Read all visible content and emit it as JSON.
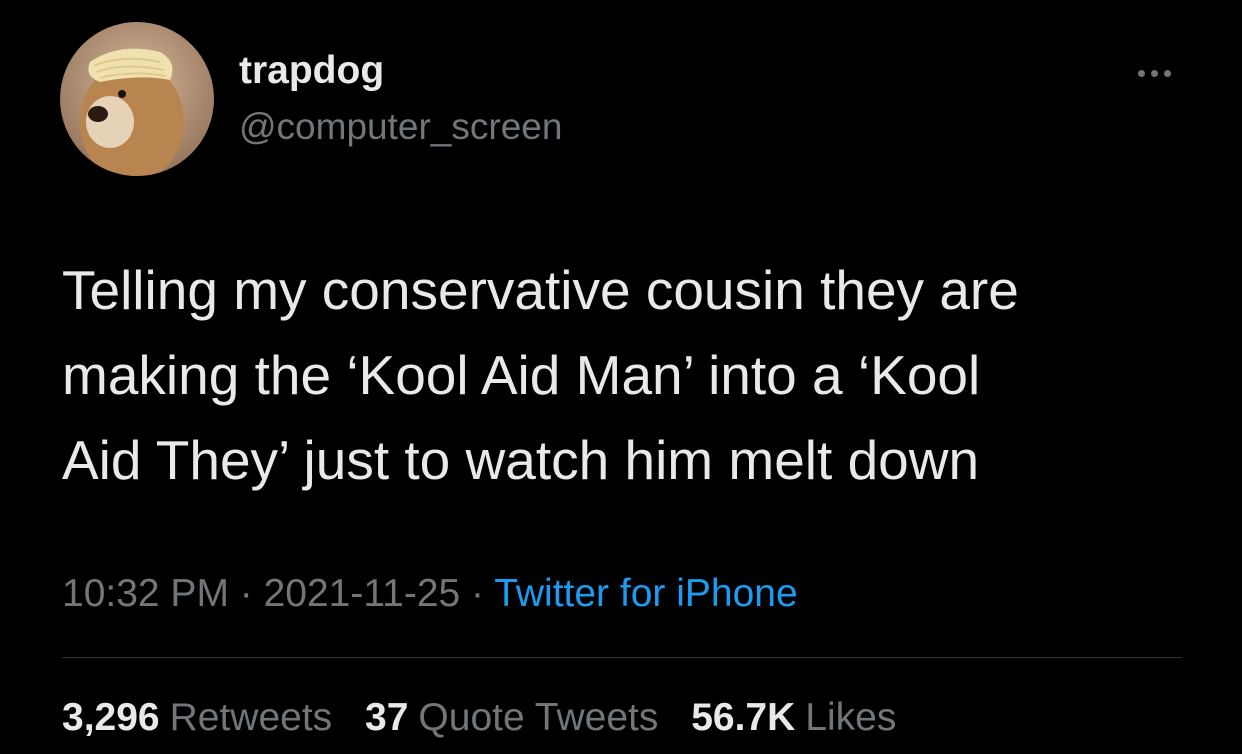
{
  "author": {
    "display_name": "trapdog",
    "handle": "@computer_screen",
    "avatar_icon": "dog-with-noodles-avatar"
  },
  "menu": {
    "icon": "more-options-icon"
  },
  "tweet": {
    "lines": [
      "Telling my conservative cousin they are",
      "making the ‘Kool Aid Man’ into a ‘Kool",
      "Aid They’ just to watch him melt down"
    ]
  },
  "meta": {
    "time": "10:32 PM",
    "separator": " · ",
    "date": "2021-11-25",
    "source": "Twitter for iPhone"
  },
  "stats": {
    "retweets": {
      "count": "3,296",
      "label": "Retweets"
    },
    "quotes": {
      "count": "37",
      "label": "Quote Tweets"
    },
    "likes": {
      "count": "56.7K",
      "label": "Likes"
    }
  },
  "colors": {
    "background": "#000000",
    "primary_text": "#e7e9ea",
    "secondary_text": "#71767b",
    "link": "#1d9bf0",
    "divider": "#2f3336"
  }
}
